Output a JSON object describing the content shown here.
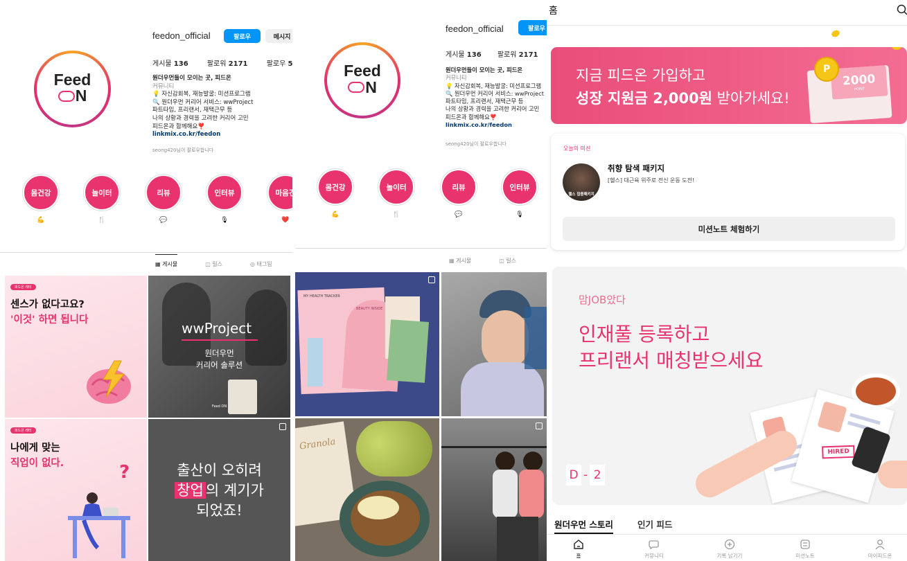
{
  "profile": {
    "username": "feedon_official",
    "follow_label": "팔로우",
    "message_label": "메시지",
    "logo_line1": "Feed",
    "logo_line2": "N",
    "stats": {
      "posts_label": "게시물",
      "posts": "136",
      "followers_label": "팔로워",
      "followers": "2171",
      "following_label": "팔로우",
      "following": "5"
    },
    "bio": {
      "line1": "원더우먼들이 모이는 곳, 피드온",
      "category": "커뮤니티",
      "line3": "💡 자신감회복, 재능발굴: 미션프로그램",
      "line4": "🔍 원더우먼 커리어 서비스: wwProject",
      "line5": "파트타임, 프리랜서, 재택근무 등",
      "line6": "나의 상황과 경력을 고려한 커리어 고민",
      "line7": "피드온과 함께해요❣️",
      "link": "linkmix.co.kr/feedon"
    },
    "followed_user": "seong420",
    "followed_suffix": "님이 팔로우합니다",
    "highlights": [
      {
        "label": "몸건강",
        "emoji": "💪"
      },
      {
        "label": "놀이터",
        "emoji": "🍴"
      },
      {
        "label": "리뷰",
        "emoji": "💬"
      },
      {
        "label": "인터뷰",
        "emoji": "🎙"
      },
      {
        "label": "마음건",
        "emoji": "❤️"
      }
    ],
    "tabs": {
      "posts": "게시물",
      "reels": "릴스",
      "tagged": "태그됨"
    }
  },
  "grid1": {
    "t1_badge": "피드온 레터",
    "t1_line1": "센스가 없다고요?",
    "t1_line2": "'이것' 하면 됩니다",
    "t2_title": "wwProject",
    "t2_sub1": "원더우먼",
    "t2_sub2": "커리어 솔루션",
    "t2_logo": "Feed ON",
    "t3_badge": "피드온 레터",
    "t3_line1": "나에게 맞는",
    "t3_line2": "직업이 없다.",
    "t4_line1": "출산이 오히려",
    "t4_hl": "창업",
    "t4_line2b": "의 계기가",
    "t4_line3": "되었죠!"
  },
  "grid2": {
    "t1_label": "MY HEALTH TRACKER",
    "t1_sub": "BEAUTY INSIDE",
    "t3_label": "Granola"
  },
  "app": {
    "header_title": "홈",
    "banner1_line1": "지금 피드온 가입하고",
    "banner1_bold": "성장 지원금 2,000원",
    "banner1_rest": " 받아가세요!",
    "banner1_coin": "2000",
    "banner1_coin_sub": "POINT",
    "mission_label": "오늘의 미션",
    "mission_title": "취향 탐색 패키지",
    "mission_desc": "[헬스] 대근육 위주로 전신 운동 도전!",
    "mission_thumb": "헬스 집중패키지",
    "mission_btn": "미션노트 체험하기",
    "banner2_small": "맘JOB았다",
    "banner2_line1": "인재풀 등록하고",
    "banner2_line2": "프리랜서 매칭받으세요",
    "banner2_dday_d": "D",
    "banner2_dday_dash": "-",
    "banner2_dday_n": "2",
    "banner2_hired": "HIRED",
    "feed_tab_active": "원더우먼 스토리",
    "feed_tab_2": "인기 피드",
    "nav": [
      "홈",
      "커뮤니티",
      "기록 남기기",
      "미션노트",
      "마이피드온"
    ]
  },
  "colors": {
    "accent": "#e8336e",
    "instagram_blue": "#0095f6"
  }
}
